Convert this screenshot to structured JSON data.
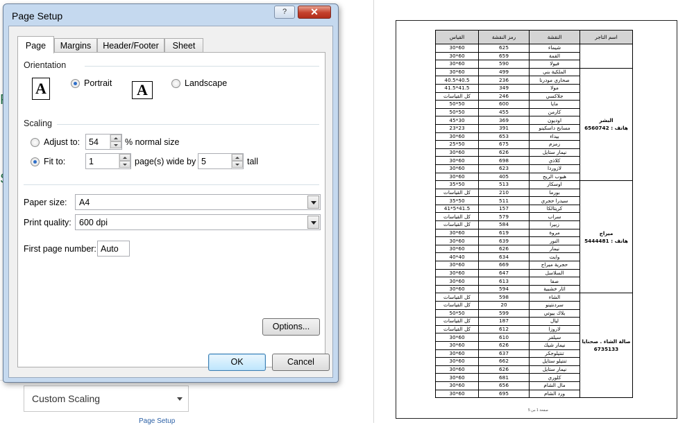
{
  "dialog": {
    "title": "Page Setup",
    "help_glyph": "?",
    "close_glyph": "✕",
    "tabs": [
      {
        "label": "Page",
        "active": true
      },
      {
        "label": "Margins",
        "active": false
      },
      {
        "label": "Header/Footer",
        "active": false
      },
      {
        "label": "Sheet",
        "active": false
      }
    ],
    "orientation": {
      "label": "Orientation",
      "portrait_label": "Portrait",
      "landscape_label": "Landscape",
      "selected": "Portrait",
      "icon_glyph": "A"
    },
    "scaling": {
      "label": "Scaling",
      "adjust_to_label": "Adjust to:",
      "adjust_to_value": "54",
      "normal_size_label": "% normal size",
      "fit_to_label": "Fit to:",
      "fit_pages_wide_value": "1",
      "pages_wide_by_label": "page(s) wide by",
      "fit_tall_value": "5",
      "tall_label": "tall",
      "selected": "Fit to"
    },
    "paper_size": {
      "label": "Paper size:",
      "value": "A4"
    },
    "print_quality": {
      "label": "Print quality:",
      "value": "600 dpi"
    },
    "first_page_number": {
      "label": "First page number:",
      "value": "Auto"
    },
    "options_button": "Options...",
    "ok_button": "OK",
    "cancel_button": "Cancel"
  },
  "background": {
    "custom_scaling": "Custom Scaling",
    "page_setup_link": "Page Setup",
    "side_letters": [
      "P",
      "S"
    ]
  },
  "preview": {
    "headers": [
      "القياس",
      "رمز النقشة",
      "النقشة",
      "اسم التاجر"
    ],
    "groups": [
      {
        "merchant": "",
        "rows": [
          [
            "30*60",
            "625",
            "شيماء"
          ],
          [
            "30*60",
            "659",
            "القمة"
          ],
          [
            "30*60",
            "590",
            "فيولا"
          ]
        ]
      },
      {
        "merchant": "البشر\nهاتف : 6560742",
        "rows": [
          [
            "30*60",
            "499",
            "الملكية بني"
          ],
          [
            "40.5*40.5",
            "236",
            "صحاري مودرنا"
          ],
          [
            "41.5*41.5",
            "349",
            "مولا"
          ],
          [
            "كل القياسات",
            "246",
            "جلاكسي"
          ],
          [
            "50*50",
            "600",
            "مايا"
          ],
          [
            "50*50",
            "455",
            "كارمن"
          ],
          [
            "45*30",
            "369",
            "اوديون"
          ],
          [
            "23*23",
            "391",
            "مسابح داسكينو"
          ],
          [
            "30*60",
            "653",
            "بيداء"
          ],
          [
            "25*50",
            "675",
            "زمزم"
          ],
          [
            "30*60",
            "626",
            "نيمار ستايل"
          ],
          [
            "30*60",
            "698",
            "كلاذي"
          ],
          [
            "30*60",
            "623",
            "لازوردا"
          ],
          [
            "30*60",
            "405",
            "هبوب الريح"
          ]
        ]
      },
      {
        "merchant": "ميراج\nهاتف : 5444481",
        "rows": [
          [
            "35*50",
            "513",
            "اوسكار"
          ],
          [
            "كل القياسات",
            "210",
            "بورما"
          ],
          [
            "35*50",
            "511",
            "سيدرا حجري"
          ],
          [
            "41*5*41.5",
            "157",
            "كريتالكا"
          ],
          [
            "كل القياسات",
            "579",
            "سراب"
          ],
          [
            "كل القياسات",
            "584",
            "زبيرا"
          ],
          [
            "30*60",
            "619",
            "مروة"
          ],
          [
            "30*60",
            "639",
            "النور"
          ],
          [
            "30*60",
            "626",
            "نيمار"
          ],
          [
            "40*40",
            "634",
            "وايت"
          ],
          [
            "30*60",
            "669",
            "حجرية ميراج"
          ],
          [
            "30*60",
            "647",
            "السلاسل"
          ],
          [
            "30*60",
            "613",
            "صفا"
          ],
          [
            "30*60",
            "594",
            "اثار خشبية"
          ]
        ]
      },
      {
        "merchant": "صالة الشاء . صحنايا\n6735133",
        "rows": [
          [
            "كل القياسات",
            "598",
            "الشاء"
          ],
          [
            "كل القياسات",
            "20",
            "سردنتينو"
          ],
          [
            "50*50",
            "599",
            "بلاك بيوتي"
          ],
          [
            "كل القياسات",
            "187",
            "ليال"
          ],
          [
            "كل القياسات",
            "612",
            "لاروزا"
          ],
          [
            "30*60",
            "610",
            "سيلفر"
          ],
          [
            "30*60",
            "626",
            "نيمار شيك"
          ],
          [
            "30*60",
            "637",
            "تنتيلوجكر"
          ],
          [
            "30*60",
            "662",
            "تنتيلو ستايل"
          ],
          [
            "30*60",
            "626",
            "نيمار ستايل"
          ],
          [
            "30*60",
            "681",
            "كلوري"
          ],
          [
            "30*60",
            "656",
            "مال الشام"
          ],
          [
            "30*60",
            "695",
            "ورد الشام"
          ]
        ]
      }
    ],
    "page_number": "صفحة 1 من 5"
  }
}
